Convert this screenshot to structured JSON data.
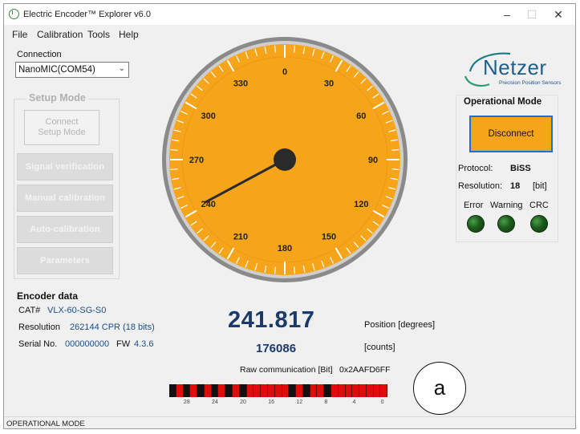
{
  "window": {
    "title": "Electric Encoder™ Explorer v6.0",
    "minimize_glyph": "–",
    "maximize_glyph": "☐",
    "close_glyph": "✕"
  },
  "menu": [
    "File",
    "Calibration",
    "Tools",
    "Help"
  ],
  "connection": {
    "label": "Connection",
    "selected": "NanoMIC(COM54)"
  },
  "setup_mode": {
    "title": "Setup Mode",
    "connect_line1": "Connect",
    "connect_line2": "Setup Mode",
    "buttons": [
      "Signal verification",
      "Manual calibration",
      "Auto-calibration",
      "Parameters"
    ]
  },
  "encoder_data": {
    "title": "Encoder data",
    "cat_label": "CAT#",
    "cat_value": "VLX-60-SG-S0",
    "resolution_label": "Resolution",
    "resolution_value": "262144 CPR (18 bits)",
    "serial_label": "Serial No.",
    "serial_value": "000000000",
    "fw_label": "FW",
    "fw_value": "4.3.6"
  },
  "gauge": {
    "position_degrees": 241.817,
    "labels": [
      "0",
      "30",
      "60",
      "90",
      "120",
      "150",
      "180",
      "210",
      "240",
      "270",
      "300",
      "330"
    ]
  },
  "readout": {
    "position": "241.817",
    "position_unit": "Position [degrees]",
    "counts": "176086",
    "counts_unit": "[counts]",
    "raw_label": "Raw communication [Bit]",
    "raw_value": "0x2AAFD6FF",
    "bit_labels": [
      "28",
      "24",
      "20",
      "16",
      "12",
      "8",
      "4",
      "0"
    ]
  },
  "brand": {
    "name": "Netzer",
    "tagline": "Precision Position Sensors",
    "accent": "#1a7a8a"
  },
  "operational_mode": {
    "title": "Operational Mode",
    "disconnect_label": "Disconnect",
    "protocol_label": "Protocol:",
    "protocol_value": "BiSS",
    "resolution_label": "Resolution:",
    "resolution_value": "18",
    "resolution_unit": "[bit]",
    "indicators": [
      "Error",
      "Warning",
      "CRC"
    ]
  },
  "callout": "a",
  "status": "OPERATIONAL MODE",
  "colors": {
    "gauge_face": "#f6a51b",
    "gauge_ring": "#7c7c7c",
    "led_on": "#1d5a1d",
    "bit_one": "#e10b0b",
    "bit_zero": "#111111",
    "readout_text": "#1b3a6b"
  }
}
